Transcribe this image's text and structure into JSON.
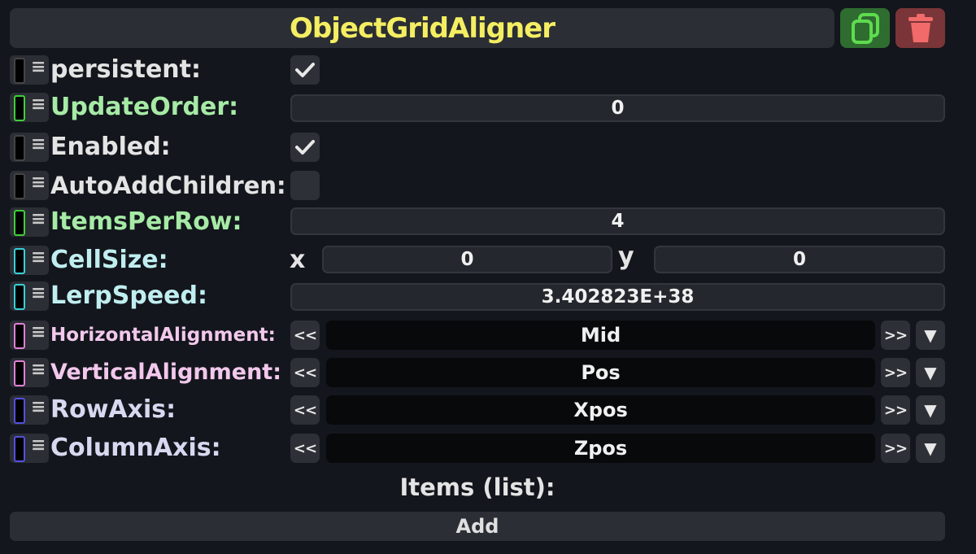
{
  "header": {
    "title": "ObjectGridAligner",
    "copy_icon": "copy-icon",
    "delete_icon": "trash-icon"
  },
  "colors": {
    "title": "#f4ee62",
    "green": "#5edc4e",
    "cyan": "#38d0d8",
    "pink": "#e080d8",
    "blue": "#5450e0",
    "black": "#000000"
  },
  "fields": {
    "persistent": {
      "label": "persistent:",
      "checked": true
    },
    "update_order": {
      "label": "UpdateOrder:",
      "value": "0"
    },
    "enabled": {
      "label": "Enabled:",
      "checked": true
    },
    "auto_add_children": {
      "label": "AutoAddChildren:",
      "checked": false
    },
    "items_per_row": {
      "label": "ItemsPerRow:",
      "value": "4"
    },
    "cell_size": {
      "label": "CellSize:",
      "x_label": "x",
      "x_value": "0",
      "y_label": "y",
      "y_value": "0"
    },
    "lerp_speed": {
      "label": "LerpSpeed:",
      "value": "3.402823E+38"
    },
    "horizontal_alignment": {
      "label": "HorizontalAlignment:",
      "value": "Mid"
    },
    "vertical_alignment": {
      "label": "VerticalAlignment:",
      "value": "Pos"
    },
    "row_axis": {
      "label": "RowAxis:",
      "value": "Xpos"
    },
    "column_axis": {
      "label": "ColumnAxis:",
      "value": "Zpos"
    }
  },
  "enum_controls": {
    "prev": "<<",
    "next": ">>",
    "dropdown": "▼"
  },
  "items": {
    "label": "Items (list):",
    "add_label": "Add"
  }
}
